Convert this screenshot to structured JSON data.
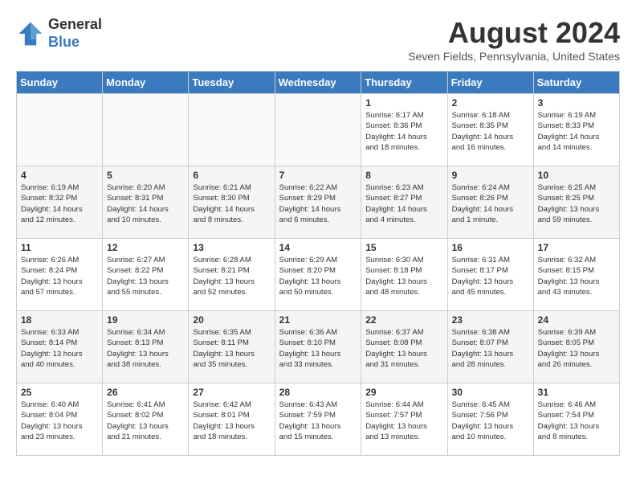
{
  "header": {
    "logo_general": "General",
    "logo_blue": "Blue",
    "month_year": "August 2024",
    "location": "Seven Fields, Pennsylvania, United States"
  },
  "calendar": {
    "days_of_week": [
      "Sunday",
      "Monday",
      "Tuesday",
      "Wednesday",
      "Thursday",
      "Friday",
      "Saturday"
    ],
    "weeks": [
      [
        {
          "day": "",
          "info": ""
        },
        {
          "day": "",
          "info": ""
        },
        {
          "day": "",
          "info": ""
        },
        {
          "day": "",
          "info": ""
        },
        {
          "day": "1",
          "info": "Sunrise: 6:17 AM\nSunset: 8:36 PM\nDaylight: 14 hours\nand 18 minutes."
        },
        {
          "day": "2",
          "info": "Sunrise: 6:18 AM\nSunset: 8:35 PM\nDaylight: 14 hours\nand 16 minutes."
        },
        {
          "day": "3",
          "info": "Sunrise: 6:19 AM\nSunset: 8:33 PM\nDaylight: 14 hours\nand 14 minutes."
        }
      ],
      [
        {
          "day": "4",
          "info": "Sunrise: 6:19 AM\nSunset: 8:32 PM\nDaylight: 14 hours\nand 12 minutes."
        },
        {
          "day": "5",
          "info": "Sunrise: 6:20 AM\nSunset: 8:31 PM\nDaylight: 14 hours\nand 10 minutes."
        },
        {
          "day": "6",
          "info": "Sunrise: 6:21 AM\nSunset: 8:30 PM\nDaylight: 14 hours\nand 8 minutes."
        },
        {
          "day": "7",
          "info": "Sunrise: 6:22 AM\nSunset: 8:29 PM\nDaylight: 14 hours\nand 6 minutes."
        },
        {
          "day": "8",
          "info": "Sunrise: 6:23 AM\nSunset: 8:27 PM\nDaylight: 14 hours\nand 4 minutes."
        },
        {
          "day": "9",
          "info": "Sunrise: 6:24 AM\nSunset: 8:26 PM\nDaylight: 14 hours\nand 1 minute."
        },
        {
          "day": "10",
          "info": "Sunrise: 6:25 AM\nSunset: 8:25 PM\nDaylight: 13 hours\nand 59 minutes."
        }
      ],
      [
        {
          "day": "11",
          "info": "Sunrise: 6:26 AM\nSunset: 8:24 PM\nDaylight: 13 hours\nand 57 minutes."
        },
        {
          "day": "12",
          "info": "Sunrise: 6:27 AM\nSunset: 8:22 PM\nDaylight: 13 hours\nand 55 minutes."
        },
        {
          "day": "13",
          "info": "Sunrise: 6:28 AM\nSunset: 8:21 PM\nDaylight: 13 hours\nand 52 minutes."
        },
        {
          "day": "14",
          "info": "Sunrise: 6:29 AM\nSunset: 8:20 PM\nDaylight: 13 hours\nand 50 minutes."
        },
        {
          "day": "15",
          "info": "Sunrise: 6:30 AM\nSunset: 8:18 PM\nDaylight: 13 hours\nand 48 minutes."
        },
        {
          "day": "16",
          "info": "Sunrise: 6:31 AM\nSunset: 8:17 PM\nDaylight: 13 hours\nand 45 minutes."
        },
        {
          "day": "17",
          "info": "Sunrise: 6:32 AM\nSunset: 8:15 PM\nDaylight: 13 hours\nand 43 minutes."
        }
      ],
      [
        {
          "day": "18",
          "info": "Sunrise: 6:33 AM\nSunset: 8:14 PM\nDaylight: 13 hours\nand 40 minutes."
        },
        {
          "day": "19",
          "info": "Sunrise: 6:34 AM\nSunset: 8:13 PM\nDaylight: 13 hours\nand 38 minutes."
        },
        {
          "day": "20",
          "info": "Sunrise: 6:35 AM\nSunset: 8:11 PM\nDaylight: 13 hours\nand 35 minutes."
        },
        {
          "day": "21",
          "info": "Sunrise: 6:36 AM\nSunset: 8:10 PM\nDaylight: 13 hours\nand 33 minutes."
        },
        {
          "day": "22",
          "info": "Sunrise: 6:37 AM\nSunset: 8:08 PM\nDaylight: 13 hours\nand 31 minutes."
        },
        {
          "day": "23",
          "info": "Sunrise: 6:38 AM\nSunset: 8:07 PM\nDaylight: 13 hours\nand 28 minutes."
        },
        {
          "day": "24",
          "info": "Sunrise: 6:39 AM\nSunset: 8:05 PM\nDaylight: 13 hours\nand 26 minutes."
        }
      ],
      [
        {
          "day": "25",
          "info": "Sunrise: 6:40 AM\nSunset: 8:04 PM\nDaylight: 13 hours\nand 23 minutes."
        },
        {
          "day": "26",
          "info": "Sunrise: 6:41 AM\nSunset: 8:02 PM\nDaylight: 13 hours\nand 21 minutes."
        },
        {
          "day": "27",
          "info": "Sunrise: 6:42 AM\nSunset: 8:01 PM\nDaylight: 13 hours\nand 18 minutes."
        },
        {
          "day": "28",
          "info": "Sunrise: 6:43 AM\nSunset: 7:59 PM\nDaylight: 13 hours\nand 15 minutes."
        },
        {
          "day": "29",
          "info": "Sunrise: 6:44 AM\nSunset: 7:57 PM\nDaylight: 13 hours\nand 13 minutes."
        },
        {
          "day": "30",
          "info": "Sunrise: 6:45 AM\nSunset: 7:56 PM\nDaylight: 13 hours\nand 10 minutes."
        },
        {
          "day": "31",
          "info": "Sunrise: 6:46 AM\nSunset: 7:54 PM\nDaylight: 13 hours\nand 8 minutes."
        }
      ]
    ]
  }
}
